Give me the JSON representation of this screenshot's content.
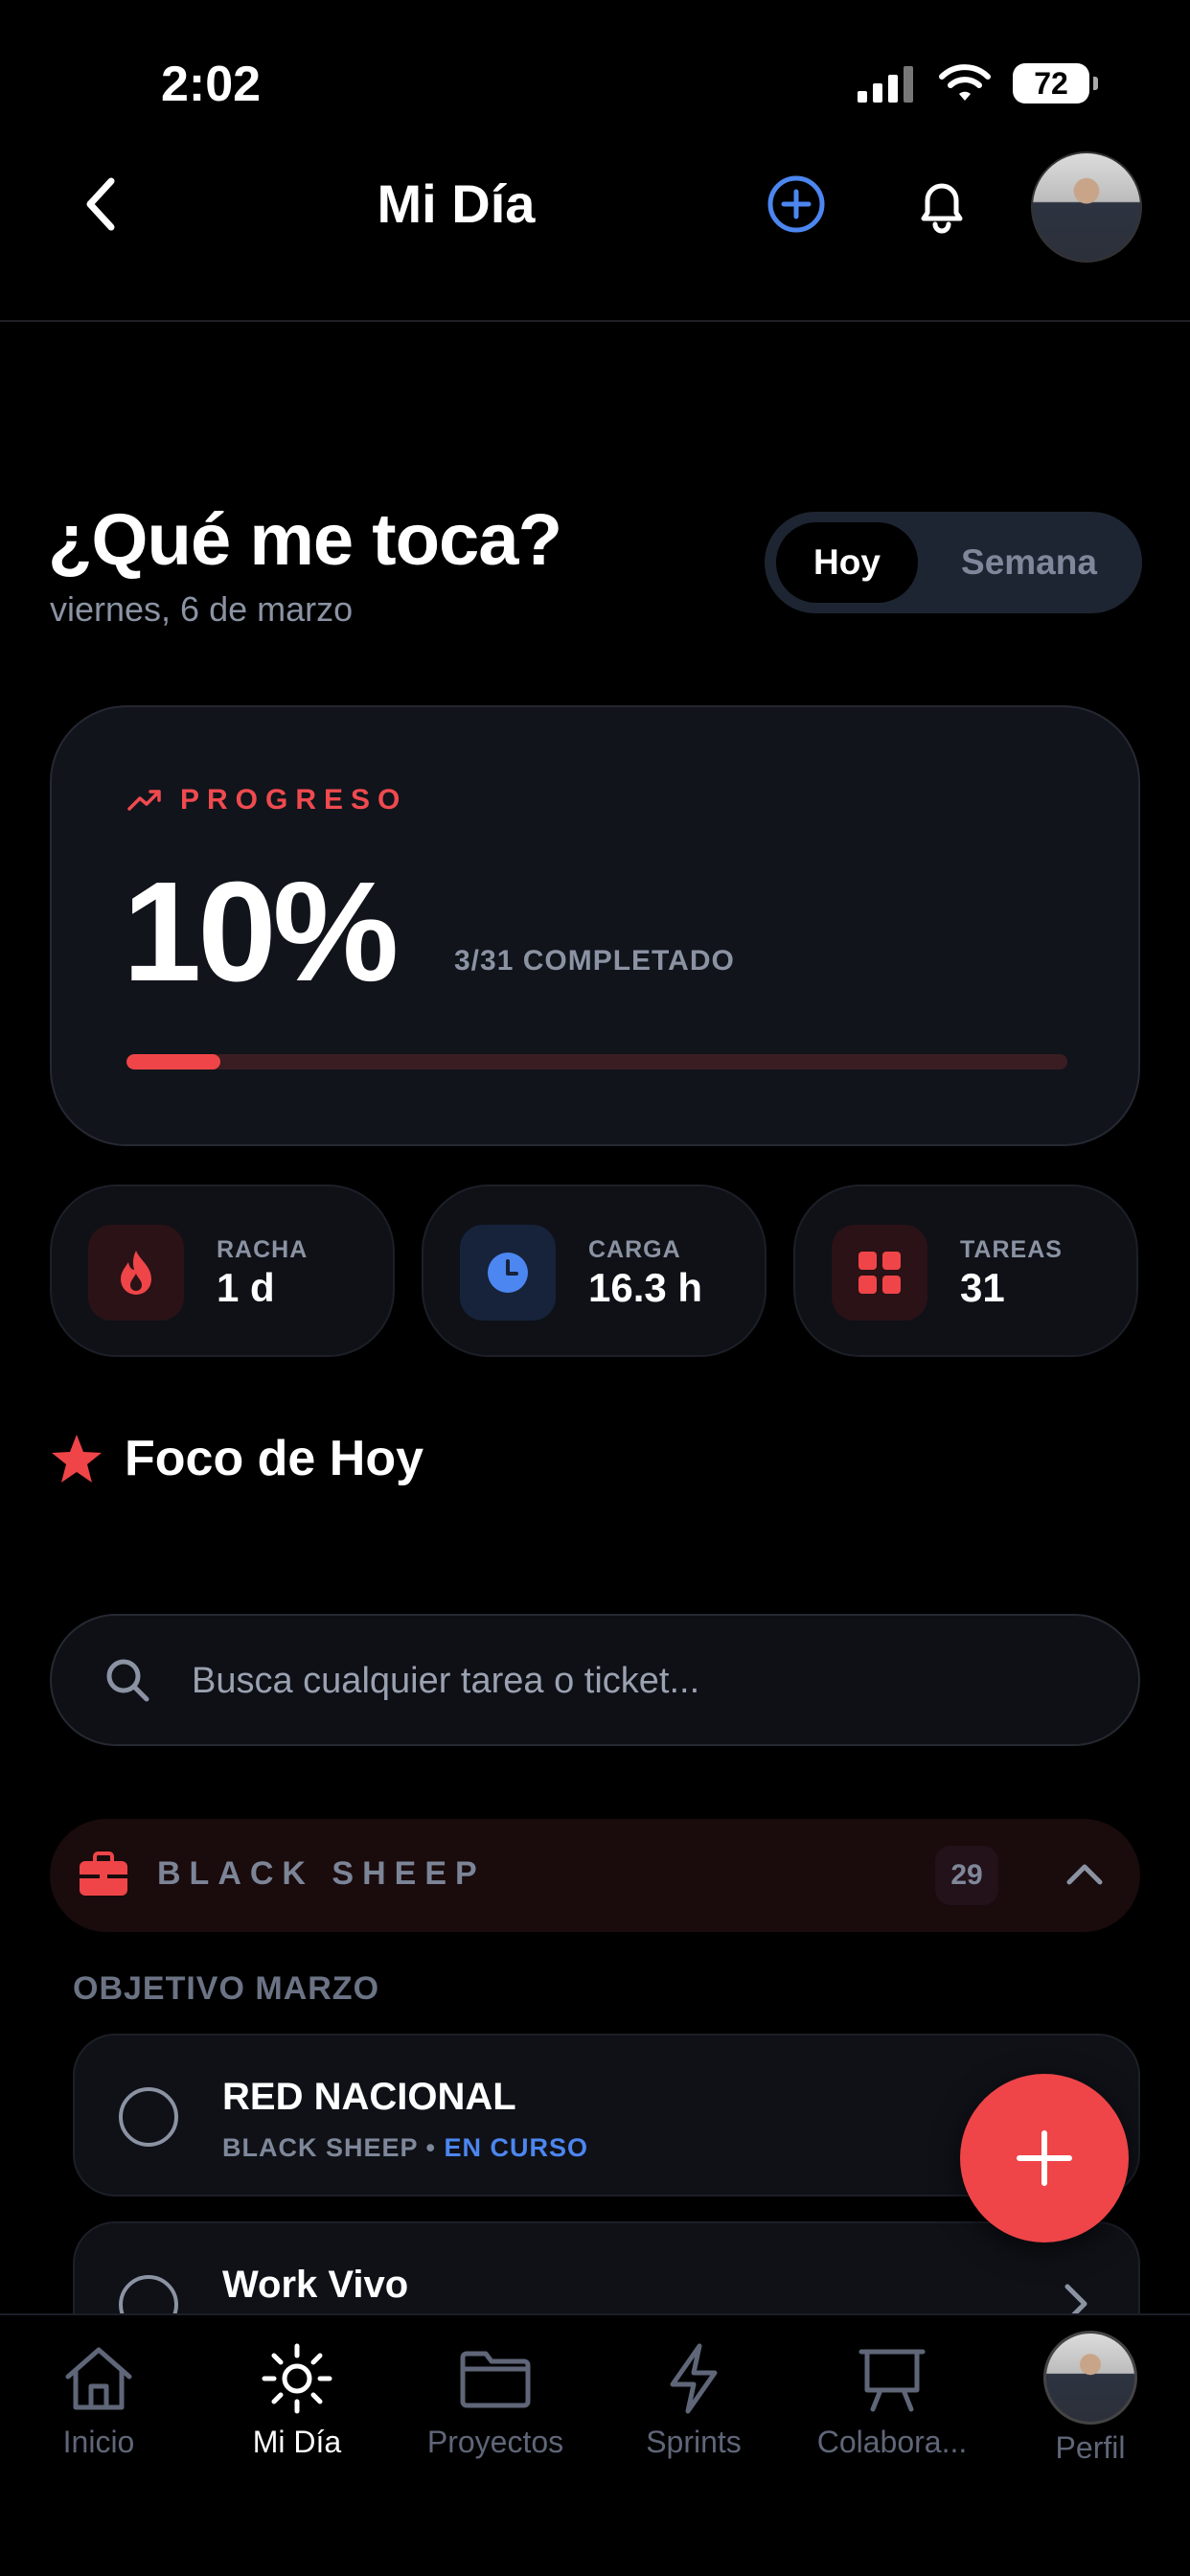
{
  "status_bar": {
    "time": "2:02",
    "battery": "72"
  },
  "header": {
    "title": "Mi Día"
  },
  "heading": {
    "title": "¿Qué me toca?",
    "date": "viernes, 6 de marzo"
  },
  "segment": {
    "options": [
      "Hoy",
      "Semana"
    ],
    "selected": "Hoy"
  },
  "progress": {
    "label": "PROGRESO",
    "percent_text": "10%",
    "completed": "3/31 COMPLETADO",
    "fraction": 0.1
  },
  "stats": [
    {
      "label": "RACHA",
      "value": "1 d",
      "icon": "flame-icon"
    },
    {
      "label": "CARGA",
      "value": "16.3 h",
      "icon": "clock-icon"
    },
    {
      "label": "TAREAS",
      "value": "31",
      "icon": "grid-icon"
    }
  ],
  "focus": {
    "title": "Foco de Hoy"
  },
  "search": {
    "placeholder": "Busca cualquier tarea o ticket..."
  },
  "group": {
    "name": "BLACK SHEEP",
    "count": "29"
  },
  "section": {
    "label": "OBJETIVO MARZO"
  },
  "tasks": [
    {
      "title": "RED NACIONAL",
      "meta_prefix": "BLACK SHEEP • ",
      "status": "EN CURSO"
    },
    {
      "title": "Work Vivo"
    }
  ],
  "tabbar": {
    "tabs": [
      {
        "label": "Inicio",
        "icon": "home-icon"
      },
      {
        "label": "Mi Día",
        "icon": "sun-icon"
      },
      {
        "label": "Proyectos",
        "icon": "folder-icon"
      },
      {
        "label": "Sprints",
        "icon": "bolt-icon"
      },
      {
        "label": "Colabora...",
        "icon": "presentation-icon"
      },
      {
        "label": "Perfil",
        "icon": "avatar"
      }
    ],
    "active": "Mi Día"
  },
  "colors": {
    "accent_red": "#ef4548",
    "accent_blue": "#4c86f0",
    "background": "#000000"
  }
}
